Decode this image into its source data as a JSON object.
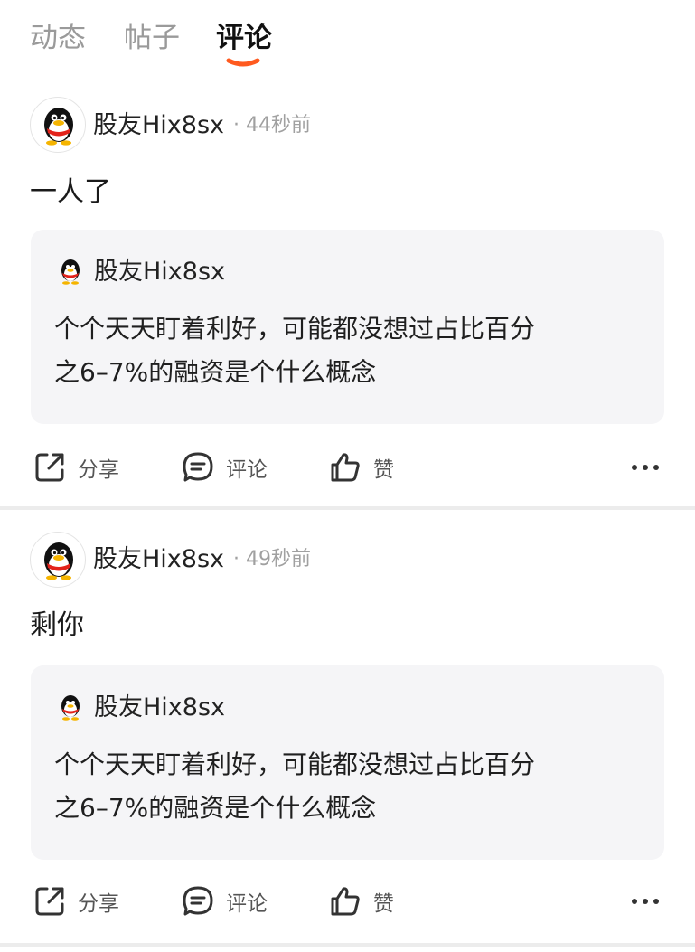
{
  "tabs": [
    {
      "label": "动态",
      "active": false
    },
    {
      "label": "帖子",
      "active": false
    },
    {
      "label": "评论",
      "active": true
    }
  ],
  "colors": {
    "accent": "#ff5a1f",
    "quote_bg": "#f5f5f7",
    "muted": "#9a9a9a"
  },
  "comments": [
    {
      "author": "股友Hix8sx",
      "time": "44秒前",
      "content": "一人了",
      "quote": {
        "author": "股友Hix8sx",
        "text_line1": "个个天天盯着利好，可能都没想过占比百分",
        "text_line2": "之6–7%的融资是个什么概念"
      },
      "actions": {
        "share": "分享",
        "comment": "评论",
        "like": "赞"
      }
    },
    {
      "author": "股友Hix8sx",
      "time": "49秒前",
      "content": "剩你",
      "quote": {
        "author": "股友Hix8sx",
        "text_line1": "个个天天盯着利好，可能都没想过占比百分",
        "text_line2": "之6–7%的融资是个什么概念"
      },
      "actions": {
        "share": "分享",
        "comment": "评论",
        "like": "赞"
      }
    }
  ]
}
